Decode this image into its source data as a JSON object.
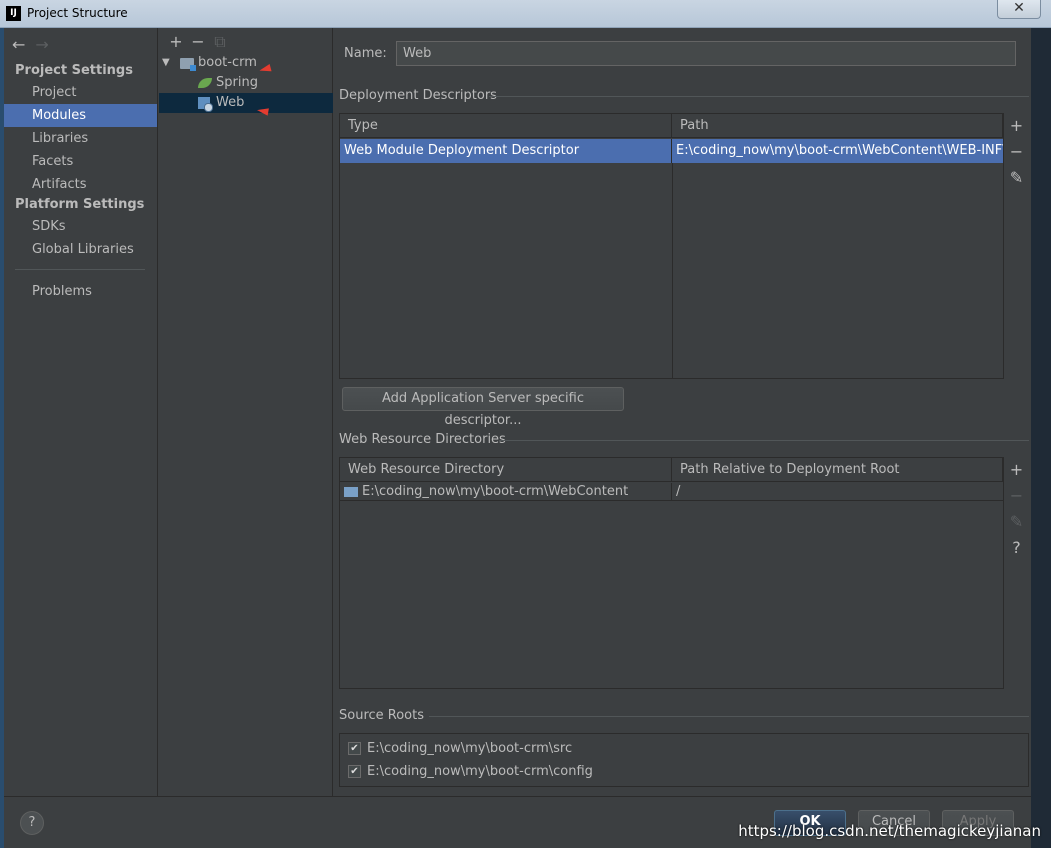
{
  "window": {
    "title": "Project Structure",
    "close_label": "✕",
    "app_icon_label": "IJ"
  },
  "sidebar": {
    "back_icon": "←",
    "forward_icon": "→",
    "project_settings_header": "Project Settings",
    "project_items": [
      "Project",
      "Modules",
      "Libraries",
      "Facets",
      "Artifacts"
    ],
    "selected_item": "Modules",
    "platform_settings_header": "Platform Settings",
    "platform_items": [
      "SDKs",
      "Global Libraries"
    ],
    "problems_label": "Problems"
  },
  "tree": {
    "toolbar": {
      "add": "+",
      "remove": "−",
      "copy": "⧉"
    },
    "root": {
      "expander": "▼",
      "label": "boot-crm"
    },
    "children": [
      {
        "label": "Spring",
        "icon": "spring-icon"
      },
      {
        "label": "Web",
        "icon": "web-facet-icon",
        "selected": true
      }
    ],
    "annotation_arrow": "◄"
  },
  "main": {
    "name_label": "Name:",
    "name_value": "Web",
    "deployment": {
      "title": "Deployment Descriptors",
      "columns": [
        "Type",
        "Path"
      ],
      "rows": [
        {
          "type": "Web Module Deployment Descriptor",
          "path": "E:\\coding_now\\my\\boot-crm\\WebContent\\WEB-INF\\web.xml"
        }
      ],
      "add_server_descriptor_label": "Add Application Server specific descriptor..."
    },
    "resources": {
      "title": "Web Resource Directories",
      "columns": [
        "Web Resource Directory",
        "Path Relative to Deployment Root"
      ],
      "rows": [
        {
          "directory": "E:\\coding_now\\my\\boot-crm\\WebContent",
          "relative": "/"
        }
      ]
    },
    "source_roots": {
      "title": "Source Roots",
      "items": [
        {
          "path": "E:\\coding_now\\my\\boot-crm\\src",
          "checked": true
        },
        {
          "path": "E:\\coding_now\\my\\boot-crm\\config",
          "checked": true
        }
      ]
    },
    "side_tools": {
      "add": "+",
      "remove": "−",
      "edit": "✎",
      "help": "?"
    }
  },
  "footer": {
    "help_label": "?",
    "ok_label": "OK",
    "cancel_label": "Cancel",
    "apply_label": "Apply",
    "watermark": "https://blog.csdn.net/themagickeyjianan"
  }
}
